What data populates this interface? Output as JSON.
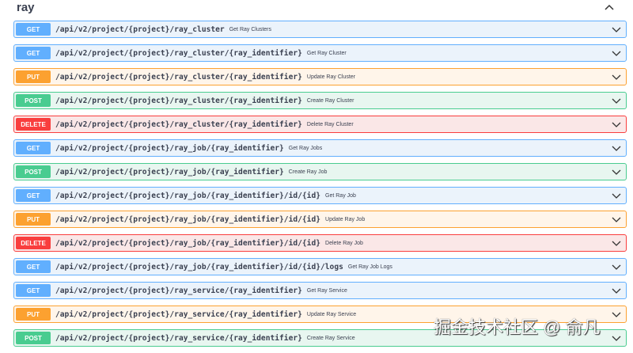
{
  "tag": {
    "title": "ray"
  },
  "operations": [
    {
      "method": "GET",
      "cls": "get",
      "path": "/api/v2/project/{project}/ray_cluster",
      "summary": "Get Ray Clusters"
    },
    {
      "method": "GET",
      "cls": "get",
      "path": "/api/v2/project/{project}/ray_cluster/{ray_identifier}",
      "summary": "Get Ray Cluster"
    },
    {
      "method": "PUT",
      "cls": "put",
      "path": "/api/v2/project/{project}/ray_cluster/{ray_identifier}",
      "summary": "Update Ray Cluster"
    },
    {
      "method": "POST",
      "cls": "post",
      "path": "/api/v2/project/{project}/ray_cluster/{ray_identifier}",
      "summary": "Create Ray Cluster"
    },
    {
      "method": "DELETE",
      "cls": "delete",
      "path": "/api/v2/project/{project}/ray_cluster/{ray_identifier}",
      "summary": "Delete Ray Cluster"
    },
    {
      "method": "GET",
      "cls": "get",
      "path": "/api/v2/project/{project}/ray_job/{ray_identifier}",
      "summary": "Get Ray Jobs"
    },
    {
      "method": "POST",
      "cls": "post",
      "path": "/api/v2/project/{project}/ray_job/{ray_identifier}",
      "summary": "Create Ray Job"
    },
    {
      "method": "GET",
      "cls": "get",
      "path": "/api/v2/project/{project}/ray_job/{ray_identifier}/id/{id}",
      "summary": "Get Ray Job"
    },
    {
      "method": "PUT",
      "cls": "put",
      "path": "/api/v2/project/{project}/ray_job/{ray_identifier}/id/{id}",
      "summary": "Update Ray Job"
    },
    {
      "method": "DELETE",
      "cls": "delete",
      "path": "/api/v2/project/{project}/ray_job/{ray_identifier}/id/{id}",
      "summary": "Delete Ray Job"
    },
    {
      "method": "GET",
      "cls": "get",
      "path": "/api/v2/project/{project}/ray_job/{ray_identifier}/id/{id}/logs",
      "summary": "Get Ray Job Logs"
    },
    {
      "method": "GET",
      "cls": "get",
      "path": "/api/v2/project/{project}/ray_service/{ray_identifier}",
      "summary": "Get Ray Service"
    },
    {
      "method": "PUT",
      "cls": "put",
      "path": "/api/v2/project/{project}/ray_service/{ray_identifier}",
      "summary": "Update Ray Service"
    },
    {
      "method": "POST",
      "cls": "post",
      "path": "/api/v2/project/{project}/ray_service/{ray_identifier}",
      "summary": "Create Ray Service"
    }
  ],
  "watermark": "掘金技术社区 @ 俞凡"
}
